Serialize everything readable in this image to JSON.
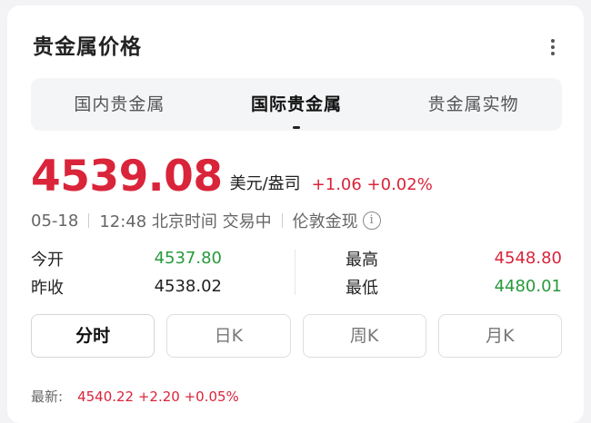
{
  "header": {
    "title": "贵金属价格"
  },
  "tabs": [
    {
      "label": "国内贵金属",
      "active": false
    },
    {
      "label": "国际贵金属",
      "active": true
    },
    {
      "label": "贵金属实物",
      "active": false
    }
  ],
  "quote": {
    "price": "4539.08",
    "unit": "美元/盎司",
    "change": "+1.06 +0.02%",
    "date": "05-18",
    "time": "12:48 北京时间 交易中",
    "market": "伦敦金现"
  },
  "stats": {
    "open_label": "今开",
    "open_value": "4537.80",
    "prev_close_label": "昨收",
    "prev_close_value": "4538.02",
    "high_label": "最高",
    "high_value": "4548.80",
    "low_label": "最低",
    "low_value": "4480.01"
  },
  "periods": [
    "分时",
    "日K",
    "周K",
    "月K"
  ],
  "latest": {
    "label": "最新:",
    "value": "4540.22 +2.20 +0.05%"
  },
  "colors": {
    "up": "#d9243a",
    "down": "#279a3c"
  }
}
